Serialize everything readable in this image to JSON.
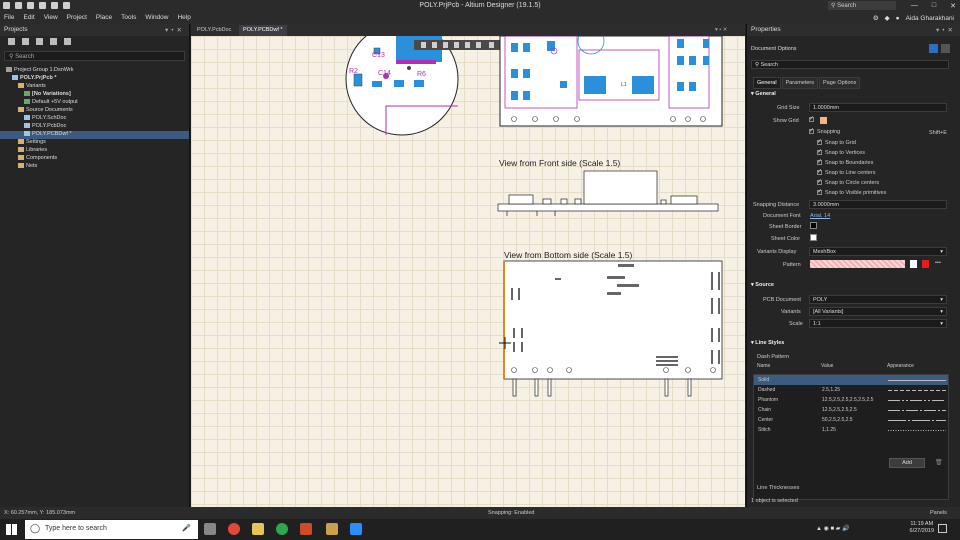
{
  "window": {
    "title": "POLY.PrjPcb - Altium Designer (19.1.5)",
    "search_placeholder": "Search"
  },
  "menu": {
    "items": [
      "File",
      "Edit",
      "View",
      "Project",
      "Place",
      "Tools",
      "Window",
      "Help"
    ],
    "user": "Aida Gharakhani"
  },
  "projects": {
    "title": "Projects",
    "search_placeholder": "Search",
    "tree": [
      {
        "label": "Project Group 1.DsnWrk",
        "indent": 0,
        "icon": "group-icon"
      },
      {
        "label": "POLY.PrjPcb *",
        "indent": 1,
        "icon": "project-icon",
        "bold": true
      },
      {
        "label": "Variants",
        "indent": 2,
        "icon": "folder-icon"
      },
      {
        "label": "[No Variations]",
        "indent": 3,
        "icon": "variant-icon",
        "bold": true
      },
      {
        "label": "Default +5V output",
        "indent": 3,
        "icon": "variant-icon"
      },
      {
        "label": "Source Documents",
        "indent": 2,
        "icon": "folder-icon"
      },
      {
        "label": "POLY.SchDoc",
        "indent": 3,
        "icon": "schdoc-icon"
      },
      {
        "label": "POLY.PcbDoc",
        "indent": 3,
        "icon": "pcbdoc-icon"
      },
      {
        "label": "POLY.PCBDwf *",
        "indent": 3,
        "icon": "pcbdwf-icon",
        "selected": true
      },
      {
        "label": "Settings",
        "indent": 2,
        "icon": "folder-icon"
      },
      {
        "label": "Libraries",
        "indent": 2,
        "icon": "folder-icon"
      },
      {
        "label": "Components",
        "indent": 2,
        "icon": "folder-icon"
      },
      {
        "label": "Nets",
        "indent": 2,
        "icon": "folder-icon"
      }
    ]
  },
  "tabs": [
    {
      "label": "POLY.PcbDoc",
      "active": false
    },
    {
      "label": "POLY.PCBDwf *",
      "active": true
    }
  ],
  "drawing": {
    "front_title": "View from Front side (Scale 1.5)",
    "bottom_title": "View from Bottom side (Scale 1.5)",
    "labels": [
      "C13",
      "C14",
      "R6",
      "R2",
      "L1"
    ]
  },
  "properties": {
    "title": "Properties",
    "header": "Document Options",
    "search_placeholder": "Search",
    "tabs": [
      "General",
      "Parameters",
      "Page Options"
    ],
    "general": {
      "section": "General",
      "grid_size_label": "Grid Size",
      "grid_size": "1.0000mm",
      "show_grid_label": "Show Grid",
      "snapping_label": "Snapping",
      "snapping_shortcut": "Shift+E",
      "snap_options": [
        "Snap to Grid",
        "Snap to Vertices",
        "Snap to Boundaries",
        "Snap to Line centers",
        "Snap to Circle centers",
        "Snap to Visible primitives"
      ],
      "snapping_distance_label": "Snapping Distance",
      "snapping_distance": "3.0000mm",
      "document_font_label": "Document Font",
      "document_font": "Arial, 14",
      "sheet_border_label": "Sheet Border",
      "sheet_color_label": "Sheet Color",
      "variants_display_label": "Variants Display",
      "variants_display": "MeshBox",
      "pattern_label": "Pattern"
    },
    "source": {
      "section": "Source",
      "pcb_document_label": "PCB Document",
      "pcb_document": "POLY",
      "variants_label": "Variants",
      "variants": "[All Variants]",
      "scale_label": "Scale",
      "scale": "1:1"
    },
    "line_styles": {
      "section": "Line Styles",
      "table_title": "Dash Pattern",
      "headers": [
        "Name",
        "Value",
        "Appearance"
      ],
      "rows": [
        {
          "name": "Solid",
          "value": "",
          "dash": ""
        },
        {
          "name": "Dashed",
          "value": "2.5,1.25",
          "dash": "4,2"
        },
        {
          "name": "Phantom",
          "value": "12.5,2.5,2.5,2.5,2.5,2.5",
          "dash": "12,2,2,2,2,2"
        },
        {
          "name": "Chain",
          "value": "12.5,2.5,2.5,2.5",
          "dash": "12,2,2,2"
        },
        {
          "name": "Center",
          "value": "50,2.5,2.5,2.5",
          "dash": "18,2,2,2"
        },
        {
          "name": "Stitch",
          "value": "1,1.25",
          "dash": "1,1.5"
        }
      ],
      "add_label": "Add",
      "thickness_label": "Line Thicknesses"
    },
    "selection_status": "1 object is selected"
  },
  "status": {
    "coords": "X: 60.257mm, Y: 185.073mm",
    "snapping": "Snapping: Enabled",
    "panels": "Panels"
  },
  "taskbar": {
    "search_placeholder": "Type here to search",
    "time": "11:19 AM",
    "date": "6/27/2019"
  },
  "colors": {
    "accent": "#3d5a80",
    "canvas": "#f6f1e4",
    "pcb_outline": "#b12fb6",
    "selection": "#e08a1c"
  }
}
